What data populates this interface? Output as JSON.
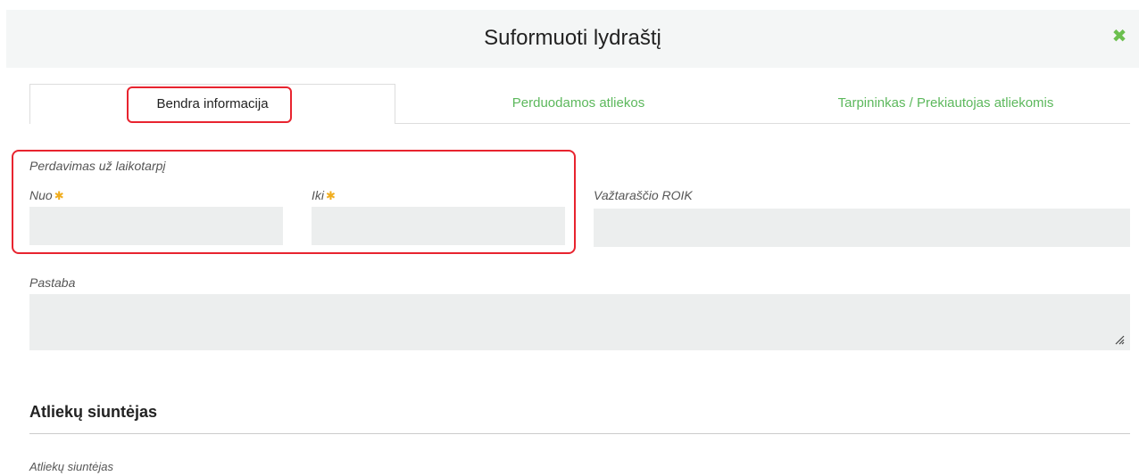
{
  "modal": {
    "title": "Suformuoti lydraštį",
    "close_icon": "close-icon"
  },
  "tabs": [
    {
      "label": "Bendra informacija",
      "active": true
    },
    {
      "label": "Perduodamos atliekos",
      "active": false
    },
    {
      "label": "Tarpininkas / Prekiautojas atliekomis",
      "active": false
    }
  ],
  "period": {
    "group_label": "Perdavimas už laikotarpį",
    "from_label": "Nuo",
    "to_label": "Iki",
    "required_mark": "✱",
    "from_value": "",
    "to_value": ""
  },
  "roik": {
    "label": "Važtaraščio ROIK",
    "value": ""
  },
  "note": {
    "label": "Pastaba",
    "value": ""
  },
  "sender_section": {
    "title": "Atliekų siuntėjas",
    "field_label": "Atliekų siuntėjas"
  },
  "colors": {
    "accent": "#5cb85c",
    "highlight": "#e8242f",
    "required": "#f0ad1e",
    "input_bg": "#eceeee"
  }
}
